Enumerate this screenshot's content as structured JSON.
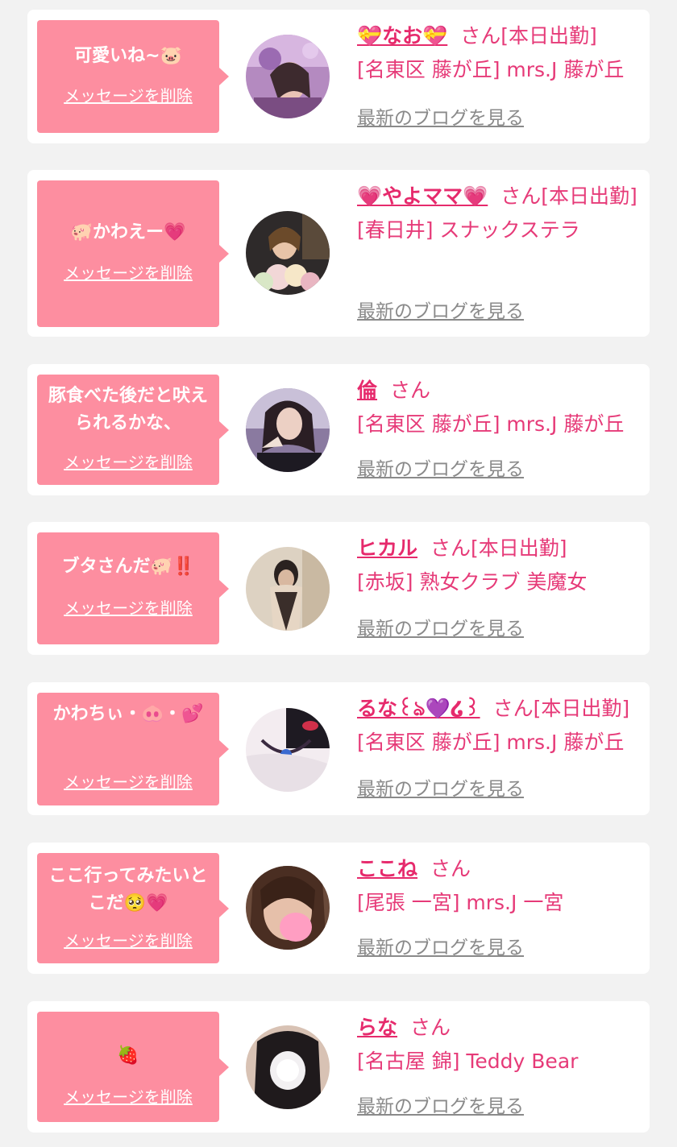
{
  "common": {
    "delete_label": "メッセージを削除",
    "blog_label": "最新のブログを見る",
    "san_label": "さん"
  },
  "colors": {
    "bubble": "#fd8ea0",
    "name": "#e62a6c",
    "text": "#e63a78",
    "link_gray": "#8a8a8a",
    "background": "#f2f2f2"
  },
  "messages": [
    {
      "message": "可愛いね~🐷",
      "name": "💝なお💝",
      "status": "[本日出勤]",
      "shop": "[名東区 藤が丘] mrs.J 藤が丘",
      "avatar_icon": "avatar-photo"
    },
    {
      "message": "🐖かわえー💗",
      "name": "💗やよママ💗",
      "status": "[本日出勤]",
      "shop": "[春日井] スナックステラ",
      "avatar_icon": "avatar-photo"
    },
    {
      "message": "豚食べた後だと吠えられるかな、",
      "name": "倫",
      "status": "",
      "shop": "[名東区 藤が丘] mrs.J 藤が丘",
      "avatar_icon": "avatar-photo"
    },
    {
      "message": "ブタさんだ🐖‼️",
      "name": "ヒカル",
      "status": "[本日出勤]",
      "shop": "[赤坂] 熟女クラブ 美魔女",
      "avatar_icon": "avatar-photo"
    },
    {
      "message": "かわちぃ・🐽・💕",
      "name": "るな꒰ঌ💜໒꒱",
      "status": "[本日出勤]",
      "shop": "[名東区 藤が丘] mrs.J 藤が丘",
      "avatar_icon": "avatar-photo"
    },
    {
      "message": "ここ行ってみたいとこだ🥺💗",
      "name": "ここね",
      "status": "",
      "shop": "[尾張 一宮] mrs.J 一宮",
      "avatar_icon": "avatar-photo"
    },
    {
      "message": "🍓",
      "name": "らな",
      "status": "",
      "shop": "[名古屋 錦] Teddy Bear",
      "avatar_icon": "avatar-photo"
    }
  ]
}
